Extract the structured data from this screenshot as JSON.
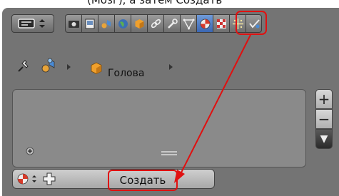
{
  "caption": "(Мозг), а затем Создать",
  "toolbar": {
    "editor_type": "properties-editor-selector",
    "tabs": [
      {
        "icon": "render-icon"
      },
      {
        "icon": "render-layers-icon"
      },
      {
        "icon": "scene-icon"
      },
      {
        "icon": "world-icon"
      },
      {
        "icon": "object-icon"
      },
      {
        "icon": "constraints-icon"
      },
      {
        "icon": "modifiers-icon"
      },
      {
        "icon": "object-data-icon"
      },
      {
        "icon": "material-icon",
        "active": true
      },
      {
        "icon": "texture-icon"
      },
      {
        "icon": "particles-icon"
      },
      {
        "icon": "physics-icon"
      }
    ]
  },
  "breadcrumb": {
    "object_name": "Голова"
  },
  "material_list": {
    "empty": true
  },
  "side_controls": {
    "add": "+",
    "remove": "−",
    "more": "▼"
  },
  "bottom": {
    "create_label": "Создать"
  },
  "annotation": {
    "highlight_color": "#e01010"
  }
}
